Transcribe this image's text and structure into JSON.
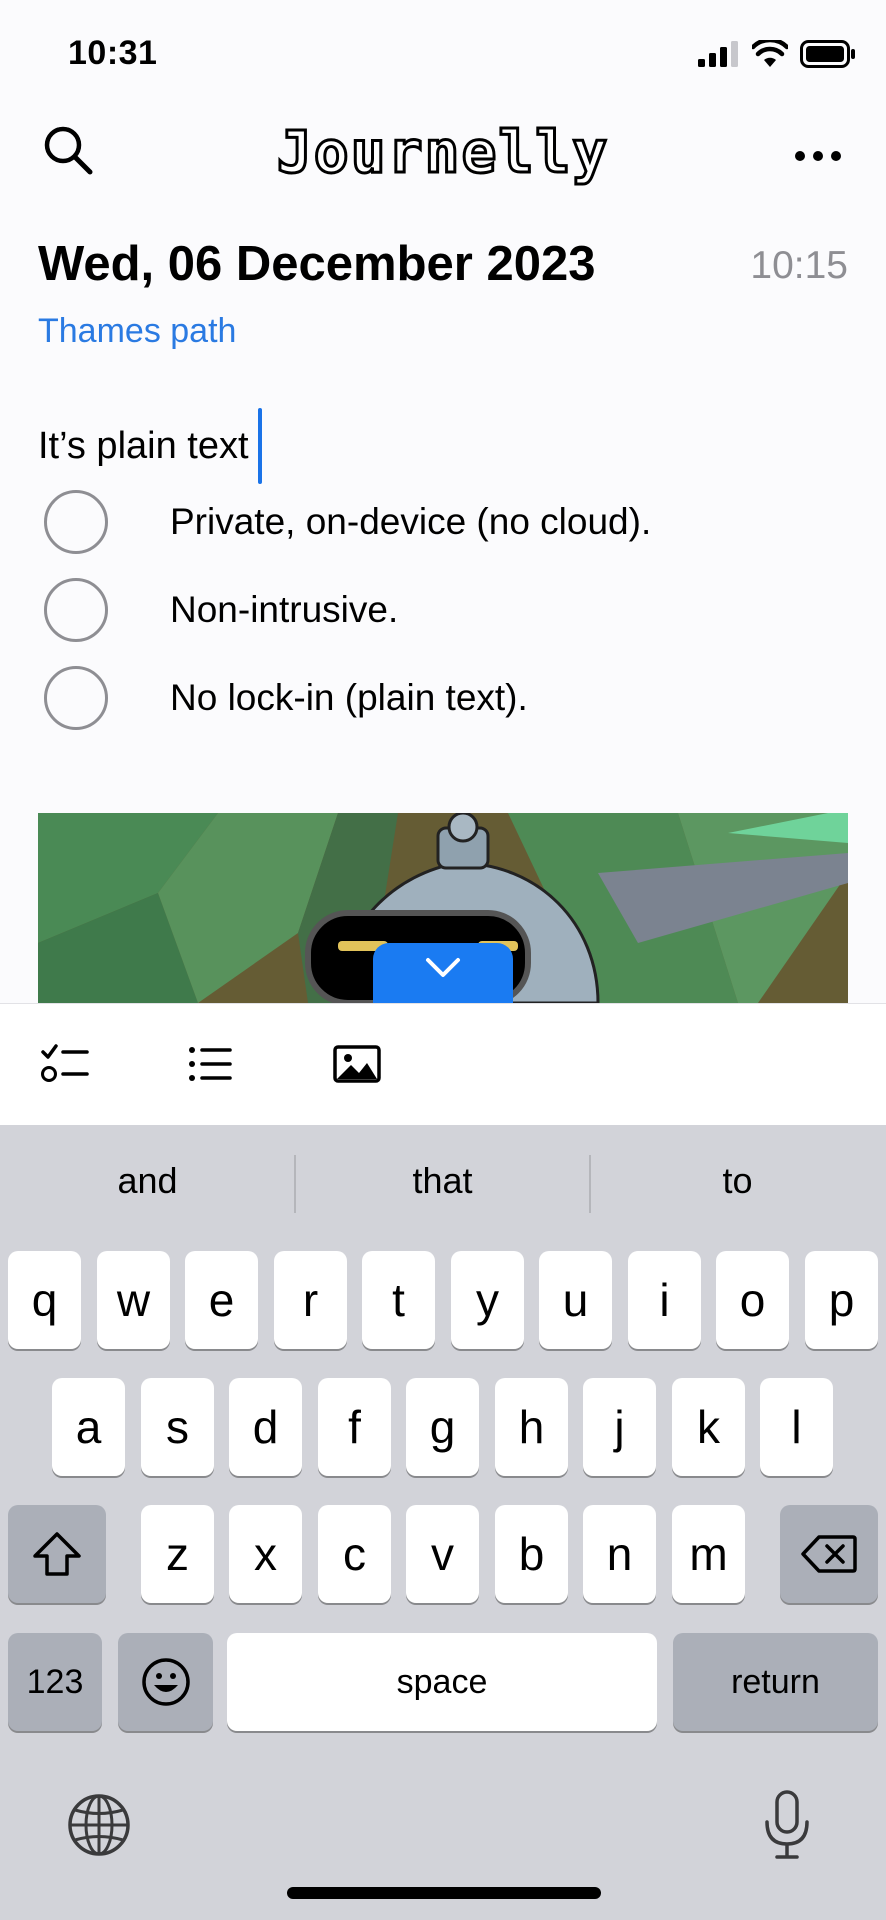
{
  "status_bar": {
    "time": "10:31"
  },
  "header": {
    "title": "Journelly"
  },
  "entry": {
    "date": "Wed, 06 December 2023",
    "time": "10:15",
    "location": "Thames path",
    "text": "It’s plain text",
    "todos": [
      {
        "label": "Private, on-device (no cloud).",
        "checked": false
      },
      {
        "label": "Non-intrusive.",
        "checked": false
      },
      {
        "label": "No lock-in (plain text).",
        "checked": false
      }
    ]
  },
  "toolbar": {
    "items": [
      {
        "icon": "checklist-icon"
      },
      {
        "icon": "bullet-list-icon"
      },
      {
        "icon": "image-icon"
      }
    ]
  },
  "keyboard": {
    "suggestions": [
      "and",
      "that",
      "to"
    ],
    "row1": [
      "q",
      "w",
      "e",
      "r",
      "t",
      "y",
      "u",
      "i",
      "o",
      "p"
    ],
    "row2": [
      "a",
      "s",
      "d",
      "f",
      "g",
      "h",
      "j",
      "k",
      "l"
    ],
    "row3": [
      "z",
      "x",
      "c",
      "v",
      "b",
      "n",
      "m"
    ],
    "numbers_key": "123",
    "space_key": "space",
    "return_key": "return"
  },
  "colors": {
    "accent": "#1a7bf2",
    "link": "#2a7ae2",
    "muted": "#8e8e93",
    "keyboard_bg": "#d2d3d9"
  }
}
